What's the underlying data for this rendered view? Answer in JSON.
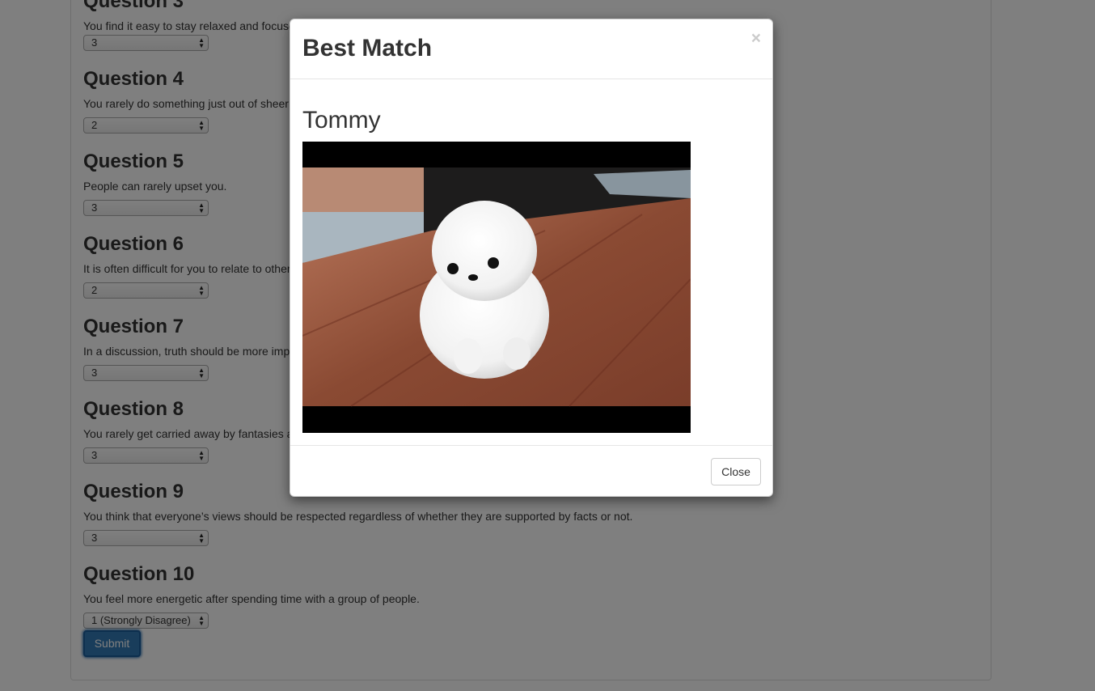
{
  "questions": [
    {
      "title": "Question 3",
      "text": "You find it easy to stay relaxed and focused even when there is",
      "answer": "3"
    },
    {
      "title": "Question 4",
      "text": "You rarely do something just out of sheer curiosity.",
      "answer": "2"
    },
    {
      "title": "Question 5",
      "text": "People can rarely upset you.",
      "answer": "3"
    },
    {
      "title": "Question 6",
      "text": "It is often difficult for you to relate to other people's feelings.",
      "answer": "2"
    },
    {
      "title": "Question 7",
      "text": "In a discussion, truth should be more important than people's sensitivities.",
      "answer": "3"
    },
    {
      "title": "Question 8",
      "text": "You rarely get carried away by fantasies and ideas.",
      "answer": "3"
    },
    {
      "title": "Question 9",
      "text": "You think that everyone’s views should be respected regardless of whether they are supported by facts or not.",
      "answer": "3"
    },
    {
      "title": "Question 10",
      "text": "You feel more energetic after spending time with a group of people.",
      "answer": "1 (Strongly Disagree)"
    }
  ],
  "submit_label": "Submit",
  "modal": {
    "title": "Best Match",
    "close_symbol": "×",
    "match_name": "Tommy",
    "photo_subject": "white pomeranian puppy on wooden floor",
    "close_label": "Close"
  },
  "colors": {
    "primary": "#337ab7",
    "backdrop": "rgba(0,0,0,0.5)"
  }
}
